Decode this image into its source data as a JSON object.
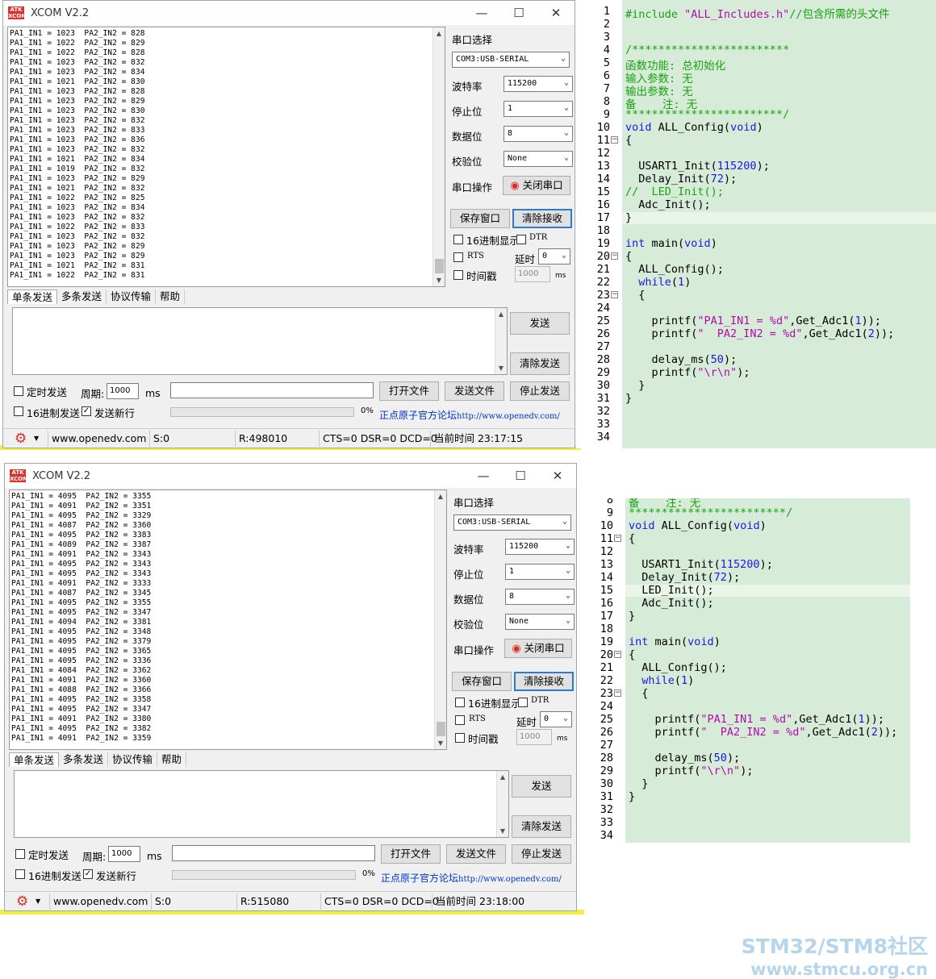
{
  "w1": {
    "title": "XCOM V2.2",
    "rx_lines": [
      "PA1_IN1 = 1023  PA2_IN2 = 828",
      "PA1_IN1 = 1022  PA2_IN2 = 829",
      "PA1_IN1 = 1022  PA2_IN2 = 828",
      "PA1_IN1 = 1023  PA2_IN2 = 832",
      "PA1_IN1 = 1023  PA2_IN2 = 834",
      "PA1_IN1 = 1021  PA2_IN2 = 830",
      "PA1_IN1 = 1023  PA2_IN2 = 828",
      "PA1_IN1 = 1023  PA2_IN2 = 829",
      "PA1_IN1 = 1023  PA2_IN2 = 830",
      "PA1_IN1 = 1023  PA2_IN2 = 832",
      "PA1_IN1 = 1023  PA2_IN2 = 833",
      "PA1_IN1 = 1023  PA2_IN2 = 836",
      "PA1_IN1 = 1023  PA2_IN2 = 832",
      "PA1_IN1 = 1021  PA2_IN2 = 834",
      "PA1_IN1 = 1019  PA2_IN2 = 832",
      "PA1_IN1 = 1023  PA2_IN2 = 829",
      "PA1_IN1 = 1021  PA2_IN2 = 832",
      "PA1_IN1 = 1022  PA2_IN2 = 825",
      "PA1_IN1 = 1023  PA2_IN2 = 834",
      "PA1_IN1 = 1023  PA2_IN2 = 832",
      "PA1_IN1 = 1022  PA2_IN2 = 833",
      "PA1_IN1 = 1023  PA2_IN2 = 832",
      "PA1_IN1 = 1023  PA2_IN2 = 829",
      "PA1_IN1 = 1023  PA2_IN2 = 829",
      "PA1_IN1 = 1021  PA2_IN2 = 831",
      "PA1_IN1 = 1022  PA2_IN2 = 831"
    ],
    "rx_count": "R:498010",
    "time": "当前时间 23:17:15"
  },
  "w2": {
    "title": "XCOM V2.2",
    "rx_lines": [
      "PA1_IN1 = 4095  PA2_IN2 = 3355",
      "PA1_IN1 = 4091  PA2_IN2 = 3351",
      "PA1_IN1 = 4095  PA2_IN2 = 3329",
      "PA1_IN1 = 4087  PA2_IN2 = 3360",
      "PA1_IN1 = 4095  PA2_IN2 = 3383",
      "PA1_IN1 = 4089  PA2_IN2 = 3387",
      "PA1_IN1 = 4091  PA2_IN2 = 3343",
      "PA1_IN1 = 4095  PA2_IN2 = 3343",
      "PA1_IN1 = 4095  PA2_IN2 = 3343",
      "PA1_IN1 = 4091  PA2_IN2 = 3333",
      "PA1_IN1 = 4087  PA2_IN2 = 3345",
      "PA1_IN1 = 4095  PA2_IN2 = 3355",
      "PA1_IN1 = 4095  PA2_IN2 = 3347",
      "PA1_IN1 = 4094  PA2_IN2 = 3381",
      "PA1_IN1 = 4095  PA2_IN2 = 3348",
      "PA1_IN1 = 4095  PA2_IN2 = 3379",
      "PA1_IN1 = 4095  PA2_IN2 = 3365",
      "PA1_IN1 = 4095  PA2_IN2 = 3336",
      "PA1_IN1 = 4084  PA2_IN2 = 3362",
      "PA1_IN1 = 4091  PA2_IN2 = 3360",
      "PA1_IN1 = 4088  PA2_IN2 = 3366",
      "PA1_IN1 = 4095  PA2_IN2 = 3358",
      "PA1_IN1 = 4095  PA2_IN2 = 3347",
      "PA1_IN1 = 4091  PA2_IN2 = 3380",
      "PA1_IN1 = 4095  PA2_IN2 = 3382",
      "PA1_IN1 = 4091  PA2_IN2 = 3359"
    ],
    "rx_count": "R:515080",
    "time": "当前时间 23:18:00"
  },
  "common": {
    "port_select": "串口选择",
    "port": "COM3:USB-SERIAL",
    "baud_label": "波特率",
    "baud": "115200",
    "stop_label": "停止位",
    "stop": "1",
    "data_label": "数据位",
    "data": "8",
    "parity_label": "校验位",
    "parity": "None",
    "op_label": "串口操作",
    "close_port": "关闭串口",
    "save_window": "保存窗口",
    "clear_recv": "清除接收",
    "hex_show": "16进制显示",
    "dtr": "DTR",
    "rts": "RTS",
    "delay_label": "延时",
    "delay": "0",
    "interval": "时间戳",
    "interval_val": "1000",
    "ms": "ms",
    "tab_single": "单条发送",
    "tab_multi": "多条发送",
    "tab_proto": "协议传输",
    "tab_help": "帮助",
    "send": "发送",
    "clear_send": "清除发送",
    "timed_send": "定时发送",
    "period_label": "周期:",
    "period": "1000",
    "open_file": "打开文件",
    "send_file": "发送文件",
    "stop_send": "停止发送",
    "hex_send": "16进制发送",
    "send_newline": "发送新行",
    "percent": "0%",
    "forum_text": "正点原子官方论坛",
    "forum_url": "http://www.openedv.com/",
    "site": "www.openedv.com",
    "s_count": "S:0",
    "lines_status": "CTS=0 DSR=0 DCD=0"
  },
  "code1": {
    "start": 1,
    "lines": [
      [
        [
          "pp",
          "#include "
        ],
        [
          "str",
          "\"ALL_Includes.h\""
        ],
        [
          "cmt",
          "//包含所需的头文件"
        ]
      ],
      [],
      [],
      [
        [
          "cmt",
          "/************************"
        ]
      ],
      [
        [
          "cmt",
          "函数功能: 总初始化"
        ]
      ],
      [
        [
          "cmt",
          "输入参数: 无"
        ]
      ],
      [
        [
          "cmt",
          "输出参数: 无"
        ]
      ],
      [
        [
          "cmt",
          "备    注: 无"
        ]
      ],
      [
        [
          "cmt",
          "************************/"
        ]
      ],
      [
        [
          "kw",
          "void"
        ],
        [
          "t",
          " ALL_Config("
        ],
        [
          "kw",
          "void"
        ],
        [
          "t",
          ")"
        ]
      ],
      [
        [
          "t",
          "{"
        ]
      ],
      [],
      [
        [
          "t",
          "  USART1_Init("
        ],
        [
          "num",
          "115200"
        ],
        [
          "t",
          ");"
        ]
      ],
      [
        [
          "t",
          "  Delay_Init("
        ],
        [
          "num",
          "72"
        ],
        [
          "t",
          ");"
        ]
      ],
      [
        [
          "cmt",
          "//  LED_Init();"
        ]
      ],
      [
        [
          "t",
          "  Adc_Init();"
        ]
      ],
      [
        [
          "t",
          "}"
        ]
      ],
      [],
      [
        [
          "kw",
          "int"
        ],
        [
          "t",
          " main("
        ],
        [
          "kw",
          "void"
        ],
        [
          "t",
          ")"
        ]
      ],
      [
        [
          "t",
          "{"
        ]
      ],
      [
        [
          "t",
          "  ALL_Config();"
        ]
      ],
      [
        [
          "t",
          "  "
        ],
        [
          "kw",
          "while"
        ],
        [
          "t",
          "("
        ],
        [
          "num",
          "1"
        ],
        [
          "t",
          ")"
        ]
      ],
      [
        [
          "t",
          "  {"
        ]
      ],
      [],
      [
        [
          "t",
          "    printf("
        ],
        [
          "str",
          "\"PA1_IN1 = %d\""
        ],
        [
          "t",
          ",Get_Adc1("
        ],
        [
          "num",
          "1"
        ],
        [
          "t",
          "));"
        ]
      ],
      [
        [
          "t",
          "    printf("
        ],
        [
          "str",
          "\"  PA2_IN2 = %d\""
        ],
        [
          "t",
          ",Get_Adc1("
        ],
        [
          "num",
          "2"
        ],
        [
          "t",
          "));"
        ]
      ],
      [],
      [
        [
          "t",
          "    delay_ms("
        ],
        [
          "num",
          "50"
        ],
        [
          "t",
          ");"
        ]
      ],
      [
        [
          "t",
          "    printf("
        ],
        [
          "str",
          "\"\\r\\n\""
        ],
        [
          "t",
          ");"
        ]
      ],
      [
        [
          "t",
          "  }"
        ]
      ],
      [
        [
          "t",
          "}"
        ]
      ],
      [],
      [],
      []
    ]
  },
  "code2": {
    "start": 8,
    "lines": [
      [
        [
          "cmt",
          "备    注: 无"
        ]
      ],
      [
        [
          "cmt",
          "************************/"
        ]
      ],
      [
        [
          "kw",
          "void"
        ],
        [
          "t",
          " ALL_Config("
        ],
        [
          "kw",
          "void"
        ],
        [
          "t",
          ")"
        ]
      ],
      [
        [
          "t",
          "{"
        ]
      ],
      [],
      [
        [
          "t",
          "  USART1_Init("
        ],
        [
          "num",
          "115200"
        ],
        [
          "t",
          ");"
        ]
      ],
      [
        [
          "t",
          "  Delay_Init("
        ],
        [
          "num",
          "72"
        ],
        [
          "t",
          ");"
        ]
      ],
      [
        [
          "t",
          "  LED_Init();"
        ]
      ],
      [
        [
          "t",
          "  Adc_Init();"
        ]
      ],
      [
        [
          "t",
          "}"
        ]
      ],
      [],
      [
        [
          "kw",
          "int"
        ],
        [
          "t",
          " main("
        ],
        [
          "kw",
          "void"
        ],
        [
          "t",
          ")"
        ]
      ],
      [
        [
          "t",
          "{"
        ]
      ],
      [
        [
          "t",
          "  ALL_Config();"
        ]
      ],
      [
        [
          "t",
          "  "
        ],
        [
          "kw",
          "while"
        ],
        [
          "t",
          "("
        ],
        [
          "num",
          "1"
        ],
        [
          "t",
          ")"
        ]
      ],
      [
        [
          "t",
          "  {"
        ]
      ],
      [],
      [
        [
          "t",
          "    printf("
        ],
        [
          "str",
          "\"PA1_IN1 = %d\""
        ],
        [
          "t",
          ",Get_Adc1("
        ],
        [
          "num",
          "1"
        ],
        [
          "t",
          "));"
        ]
      ],
      [
        [
          "t",
          "    printf("
        ],
        [
          "str",
          "\"  PA2_IN2 = %d\""
        ],
        [
          "t",
          ",Get_Adc1("
        ],
        [
          "num",
          "2"
        ],
        [
          "t",
          "));"
        ]
      ],
      [],
      [
        [
          "t",
          "    delay_ms("
        ],
        [
          "num",
          "50"
        ],
        [
          "t",
          ");"
        ]
      ],
      [
        [
          "t",
          "    printf("
        ],
        [
          "str",
          "\"\\r\\n\""
        ],
        [
          "t",
          ");"
        ]
      ],
      [
        [
          "t",
          "  }"
        ]
      ],
      [
        [
          "t",
          "}"
        ]
      ],
      [],
      [],
      []
    ]
  },
  "watermark": {
    "line1": "STM32/STM8社区",
    "line2": "www.stmcu.org.cn"
  },
  "colors": {
    "close_icon": "#e0281e",
    "accent_blue": "#2a7ad6",
    "code_bg": "#d6ecd8",
    "yellow_edge": "#f3ef3c"
  }
}
